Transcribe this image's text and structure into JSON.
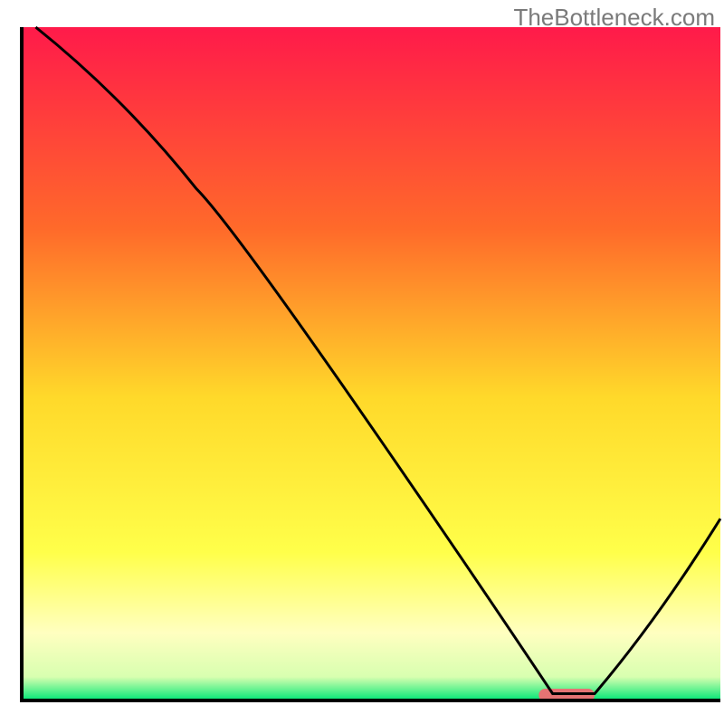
{
  "watermark": "TheBottleneck.com",
  "chart_data": {
    "type": "line",
    "title": "",
    "xlabel": "",
    "ylabel": "",
    "xlim": [
      0,
      100
    ],
    "ylim": [
      0,
      100
    ],
    "background_gradient": {
      "top": "#ff1a4a",
      "mid_upper": "#ff9a2a",
      "mid": "#ffd92a",
      "mid_lower": "#ffff66",
      "near_bottom": "#ffffc0",
      "bottom": "#00e676"
    },
    "series": [
      {
        "name": "bottleneck-curve",
        "color": "#000000",
        "x": [
          2,
          25,
          76,
          82,
          100
        ],
        "y": [
          100,
          76,
          1,
          1,
          27
        ]
      }
    ],
    "optimal_marker": {
      "color": "#e57373",
      "x_start": 74,
      "x_end": 82,
      "y": 0.8
    },
    "axis_color": "#000000",
    "axis_width": 4
  }
}
